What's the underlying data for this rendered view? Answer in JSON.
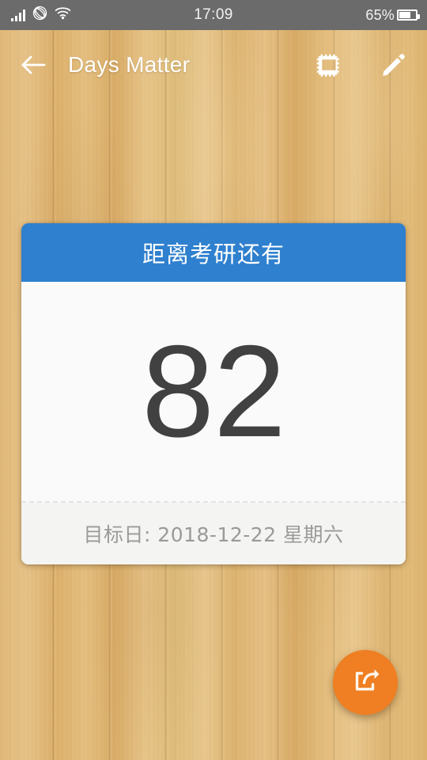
{
  "statusbar": {
    "time": "17:09",
    "battery_text": "65%",
    "battery_level": 65,
    "icons": [
      "signal-bars-icon",
      "carrier-logo-icon",
      "wifi-icon",
      "battery-icon"
    ]
  },
  "appbar": {
    "back_icon": "back-arrow-icon",
    "title": "Days Matter",
    "actions": [
      {
        "name": "stamp-icon",
        "label": "stamp"
      },
      {
        "name": "edit-pencil-icon",
        "label": "edit"
      }
    ]
  },
  "card": {
    "header_title": "距离考研还有",
    "day_count": "82",
    "target_date_label": "目标日: 2018-12-22 星期六",
    "header_color": "#2F80CE",
    "body_color": "#FAFAFA",
    "footer_color": "#F4F4F2",
    "count_color": "#414141",
    "date_color": "#9A9A9A"
  },
  "fab": {
    "icon": "share-icon",
    "color": "#EF7F22"
  },
  "background": {
    "type": "wood-texture",
    "base_color": "#DFB471"
  }
}
